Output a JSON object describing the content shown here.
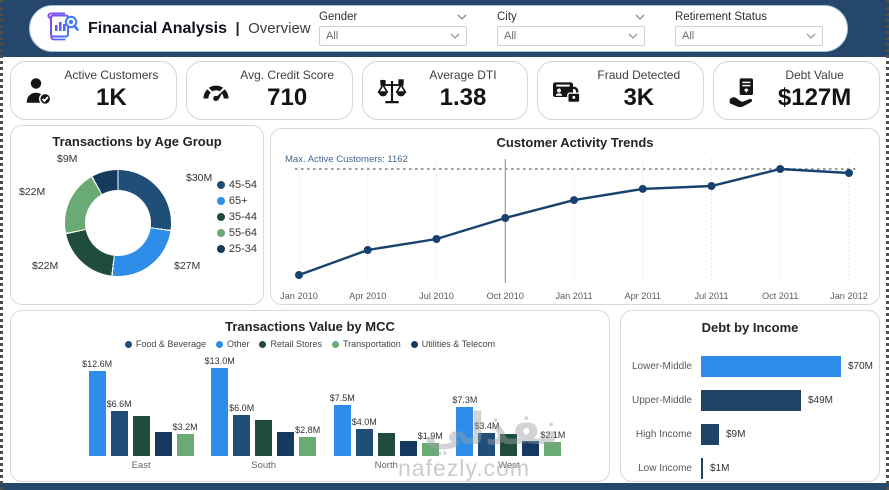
{
  "header": {
    "title": "Financial Analysis",
    "separator": "|",
    "subtitle": "Overview",
    "filters": [
      {
        "label": "Gender",
        "value": "All"
      },
      {
        "label": "City",
        "value": "All"
      },
      {
        "label": "Retirement Status",
        "value": "All"
      }
    ]
  },
  "kpis": [
    {
      "label": "Active Customers",
      "value": "1K",
      "icon": "person-check-icon"
    },
    {
      "label": "Avg. Credit Score",
      "value": "710",
      "icon": "gauge-icon"
    },
    {
      "label": "Average DTI",
      "value": "1.38",
      "icon": "balance-scale-icon"
    },
    {
      "label": "Fraud Detected",
      "value": "3K",
      "icon": "fraud-lock-icon"
    },
    {
      "label": "Debt Value",
      "value": "$127M",
      "icon": "hand-document-icon"
    }
  ],
  "chart_data": [
    {
      "type": "pie",
      "title": "Transactions by Age Group",
      "legend_position": "right",
      "slices": [
        {
          "label": "45-54",
          "value": 30,
          "display": "$30M",
          "color": "#1F4E79"
        },
        {
          "label": "65+",
          "value": 27,
          "display": "$27M",
          "color": "#2E8DE9"
        },
        {
          "label": "35-44",
          "value": 22,
          "display": "$22M",
          "color": "#1F4C3C"
        },
        {
          "label": "55-64",
          "value": 22,
          "display": "$22M",
          "color": "#6AAA74"
        },
        {
          "label": "25-34",
          "value": 9,
          "display": "$9M",
          "color": "#16395F"
        }
      ]
    },
    {
      "type": "line",
      "title": "Customer Activity Trends",
      "x": [
        "Jan 2010",
        "Apr 2010",
        "Jul 2010",
        "Oct 2010",
        "Jan 2011",
        "Apr 2011",
        "Jul 2011",
        "Oct 2011",
        "Jan 2012"
      ],
      "values": [
        582,
        719,
        779,
        894,
        992,
        1053,
        1069,
        1162,
        1140
      ],
      "max_line": {
        "label": "Max. Active Customers: 1162",
        "value": 1162
      },
      "highlight_x": "Oct 2010",
      "line_color": "#17426F",
      "ylim": [
        500,
        1220
      ],
      "grid": "vertical-dotted"
    },
    {
      "type": "bar",
      "title": "Transactions Value by MCC",
      "categories": [
        "East",
        "South",
        "North",
        "West"
      ],
      "legend": [
        {
          "label": "Food & Beverage",
          "color": "#1F4E79"
        },
        {
          "label": "Other",
          "color": "#2E8DE9"
        },
        {
          "label": "Retail Stores",
          "color": "#1F4C3C"
        },
        {
          "label": "Transportation",
          "color": "#6AAA74"
        },
        {
          "label": "Utilities & Telecom",
          "color": "#16395F"
        }
      ],
      "series": [
        {
          "name": "Other",
          "color": "#2E8DE9",
          "values": [
            12.6,
            13.0,
            7.5,
            7.3
          ],
          "labels": [
            "$12.6M",
            "$13.0M",
            "$7.5M",
            "$7.3M"
          ]
        },
        {
          "name": "Food & Beverage",
          "color": "#1F4E79",
          "values": [
            6.6,
            6.0,
            4.0,
            3.4
          ],
          "labels": [
            "$6.6M",
            "$6.0M",
            "$4.0M",
            "$3.4M"
          ]
        },
        {
          "name": "Retail Stores",
          "color": "#1F4C3C",
          "values": [
            5.9,
            5.3,
            3.4,
            3.3
          ],
          "labels": [
            "",
            "",
            "",
            ""
          ]
        },
        {
          "name": "Utilities & Telecom",
          "color": "#16395F",
          "values": [
            3.6,
            3.5,
            2.2,
            2.2
          ],
          "labels": [
            "",
            "",
            "",
            ""
          ]
        },
        {
          "name": "Transportation",
          "color": "#6AAA74",
          "values": [
            3.2,
            2.8,
            1.9,
            2.1
          ],
          "labels": [
            "$3.2M",
            "$2.8M",
            "$1.9M",
            "$2.1M"
          ]
        }
      ],
      "ylim": [
        0,
        14
      ]
    },
    {
      "type": "bar",
      "orientation": "horizontal",
      "title": "Debt by Income",
      "categories": [
        "Lower-Middle",
        "Upper-Middle",
        "High Income",
        "Low Income"
      ],
      "values": [
        70,
        49,
        9,
        1
      ],
      "labels": [
        "$70M",
        "$49M",
        "$9M",
        "$1M"
      ],
      "colors": [
        "#2E8DE9",
        "#1E4366",
        "#1E4366",
        "#1E4366"
      ],
      "xlim": [
        0,
        70
      ]
    }
  ],
  "watermark": {
    "arabic": "نفذلي",
    "domain": "nafezly.com"
  }
}
